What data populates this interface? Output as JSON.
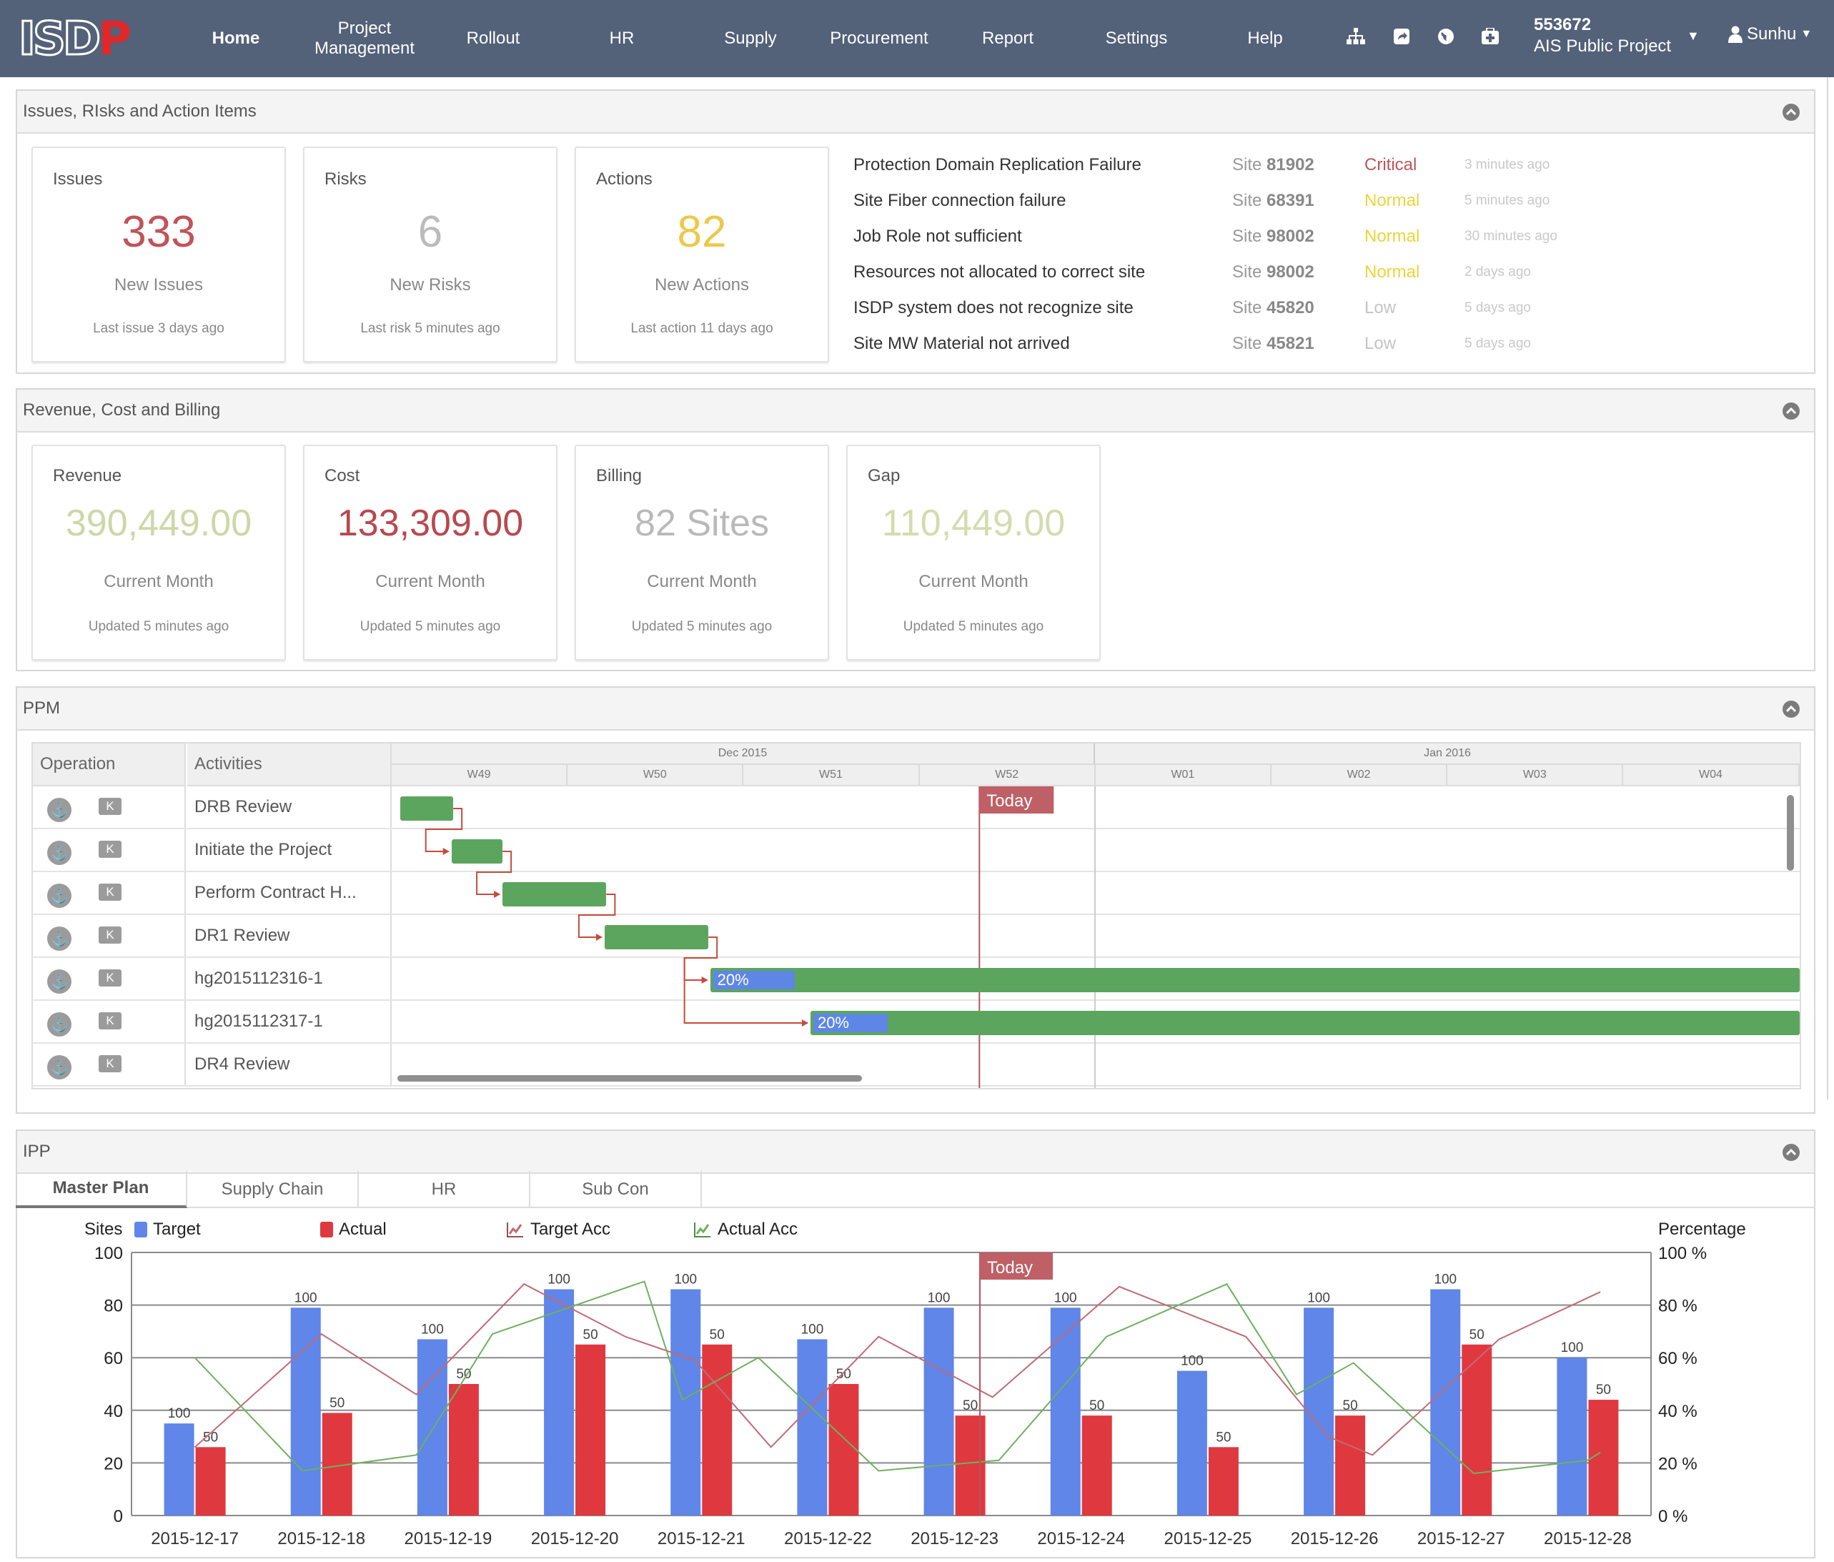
{
  "nav": {
    "logo_main": "ISD",
    "logo_accent": "P",
    "items": [
      {
        "label": "Home",
        "active": true
      },
      {
        "label": "Project\nManagement"
      },
      {
        "label": "Rollout"
      },
      {
        "label": "HR"
      },
      {
        "label": "Supply"
      },
      {
        "label": "Procurement"
      },
      {
        "label": "Report"
      },
      {
        "label": "Settings"
      },
      {
        "label": "Help"
      }
    ],
    "icons": [
      "sitemap-icon",
      "share-icon",
      "globe-icon",
      "medkit-icon"
    ],
    "project_code": "553672",
    "project_name": "AIS Public Project",
    "user": "Sunhu"
  },
  "issues_panel": {
    "title": "Issues, RIsks and Action Items",
    "cards": [
      {
        "title": "Issues",
        "value": "333",
        "sub": "New Issues",
        "foot": "Last issue 3 days ago",
        "color": "#c0545a"
      },
      {
        "title": "Risks",
        "value": "6",
        "sub": "New Risks",
        "foot": "Last risk 5 minutes ago",
        "color": "#bbbbbb"
      },
      {
        "title": "Actions",
        "value": "82",
        "sub": "New Actions",
        "foot": "Last action 11 days ago",
        "color": "#edc84a"
      }
    ],
    "list": [
      {
        "name": "Protection Domain Replication Failure",
        "site_prefix": "Site",
        "site": "81902",
        "severity": "Critical",
        "time": "3 minutes ago",
        "sev_color": "#c0545a"
      },
      {
        "name": "Site Fiber connection failure",
        "site_prefix": "Site",
        "site": "68391",
        "severity": "Normal",
        "time": "5 minutes ago",
        "sev_color": "#edd43a"
      },
      {
        "name": "Job Role not sufficient",
        "site_prefix": "Site",
        "site": "98002",
        "severity": "Normal",
        "time": "30 minutes ago",
        "sev_color": "#edd43a"
      },
      {
        "name": "Resources not allocated to correct site",
        "site_prefix": "Site",
        "site": "98002",
        "severity": "Normal",
        "time": "2 days ago",
        "sev_color": "#edd43a"
      },
      {
        "name": "ISDP system does not recognize site",
        "site_prefix": "Site",
        "site": "45820",
        "severity": "Low",
        "time": "5 days ago",
        "sev_color": "#c4c4c4"
      },
      {
        "name": "Site MW Material not arrived",
        "site_prefix": "Site",
        "site": "45821",
        "severity": "Low",
        "time": "5 days ago",
        "sev_color": "#c4c4c4"
      }
    ]
  },
  "revenue_panel": {
    "title": "Revenue, Cost and Billing",
    "cards": [
      {
        "title": "Revenue",
        "value": "390,449.00",
        "sub": "Current Month",
        "foot": "Updated 5 minutes ago",
        "color": "#cdd7a7"
      },
      {
        "title": "Cost",
        "value": "133,309.00",
        "sub": "Current Month",
        "foot": "Updated 5 minutes ago",
        "color": "#b8484f"
      },
      {
        "title": "Billing",
        "value": "82 Sites",
        "sub": "Current Month",
        "foot": "Updated 5 minutes ago",
        "color": "#b9b9b9"
      },
      {
        "title": "Gap",
        "value": "110,449.00",
        "sub": "Current Month",
        "foot": "Updated 5 minutes ago",
        "color": "#d3dcae"
      }
    ]
  },
  "ppm_panel": {
    "title": "PPM",
    "col_operation": "Operation",
    "col_activities": "Activities",
    "months": [
      "Dec 2015",
      "Jan 2016"
    ],
    "weeks": [
      "W49",
      "W50",
      "W51",
      "W52",
      "W01",
      "W02",
      "W03",
      "W04"
    ],
    "today_label": "Today",
    "today_week_position": 3.34,
    "k_label": "K",
    "rows": [
      {
        "activity": "DRB Review",
        "start_week": 0.05,
        "duration_weeks": 0.3
      },
      {
        "activity": "Initiate the Project",
        "start_week": 0.34,
        "duration_weeks": 0.29
      },
      {
        "activity": "Perform Contract H...",
        "start_week": 0.63,
        "duration_weeks": 0.59
      },
      {
        "activity": "DR1 Review",
        "start_week": 1.21,
        "duration_weeks": 0.59
      },
      {
        "activity": "hg2015112316-1",
        "start_week": 1.81,
        "duration_weeks": 6.19,
        "progress": "20%",
        "progress_fraction": 0.075
      },
      {
        "activity": "hg2015112317-1",
        "start_week": 2.38,
        "duration_weeks": 5.62,
        "progress": "20%",
        "progress_fraction": 0.075
      },
      {
        "activity": "DR4 Review"
      }
    ]
  },
  "ipp_panel": {
    "title": "IPP",
    "tabs": [
      {
        "label": "Master Plan",
        "active": true
      },
      {
        "label": "Supply Chain"
      },
      {
        "label": "HR"
      },
      {
        "label": "Sub Con"
      }
    ]
  },
  "chart_data": {
    "type": "bar",
    "title": "",
    "ylabel": "Sites",
    "y2label": "Percentage",
    "ylim": [
      0,
      100
    ],
    "y2lim": [
      0,
      100
    ],
    "yticks": [
      "0",
      "20",
      "40",
      "60",
      "80",
      "100"
    ],
    "y2ticks": [
      "0 %",
      "20 %",
      "40 %",
      "60 %",
      "80 %",
      "100 %"
    ],
    "grid": true,
    "legend_position": "top",
    "today_label": "Today",
    "today_category_position": 6.2,
    "categories": [
      "2015-12-17",
      "2015-12-18",
      "2015-12-19",
      "2015-12-20",
      "2015-12-21",
      "2015-12-22",
      "2015-12-23",
      "2015-12-24",
      "2015-12-25",
      "2015-12-26",
      "2015-12-27",
      "2015-12-28"
    ],
    "series": [
      {
        "name": "Target",
        "type": "bar",
        "color": "#5f86e8",
        "values": [
          35,
          79,
          67,
          86,
          86,
          67,
          79,
          79,
          55,
          79,
          86,
          60
        ],
        "labels": [
          "100",
          "100",
          "100",
          "100",
          "100",
          "100",
          "100",
          "100",
          "100",
          "100",
          "100",
          "100"
        ]
      },
      {
        "name": "Actual",
        "type": "bar",
        "color": "#e0383f",
        "values": [
          26,
          39,
          50,
          65,
          65,
          50,
          38,
          38,
          26,
          38,
          65,
          44
        ],
        "labels": [
          "50",
          "50",
          "50",
          "50",
          "50",
          "50",
          "50",
          "50",
          "50",
          "50",
          "50",
          "50"
        ]
      },
      {
        "name": "Target Acc",
        "type": "line",
        "color": "#c26a74",
        "axis": "right",
        "x": [
          0,
          1,
          1.75,
          2.6,
          3.4,
          3.95,
          4.55,
          5.4,
          6.3,
          7.3,
          8.3,
          8.95,
          9.3,
          10.3,
          11.1
        ],
        "values": [
          26,
          69,
          46,
          88,
          68,
          59,
          26,
          68,
          45,
          87,
          68,
          30,
          23,
          67,
          85
        ]
      },
      {
        "name": "Actual Acc",
        "type": "line",
        "color": "#6fb060",
        "axis": "right",
        "x": [
          0,
          0.85,
          1.75,
          2.35,
          3.55,
          3.85,
          4.45,
          5.4,
          6.35,
          7.2,
          8.15,
          8.7,
          9.15,
          10.1,
          11.0,
          11.1
        ],
        "values": [
          60,
          17,
          23,
          69,
          89,
          44,
          60,
          17,
          21,
          68,
          88,
          46,
          58,
          16,
          21,
          24
        ]
      }
    ]
  }
}
